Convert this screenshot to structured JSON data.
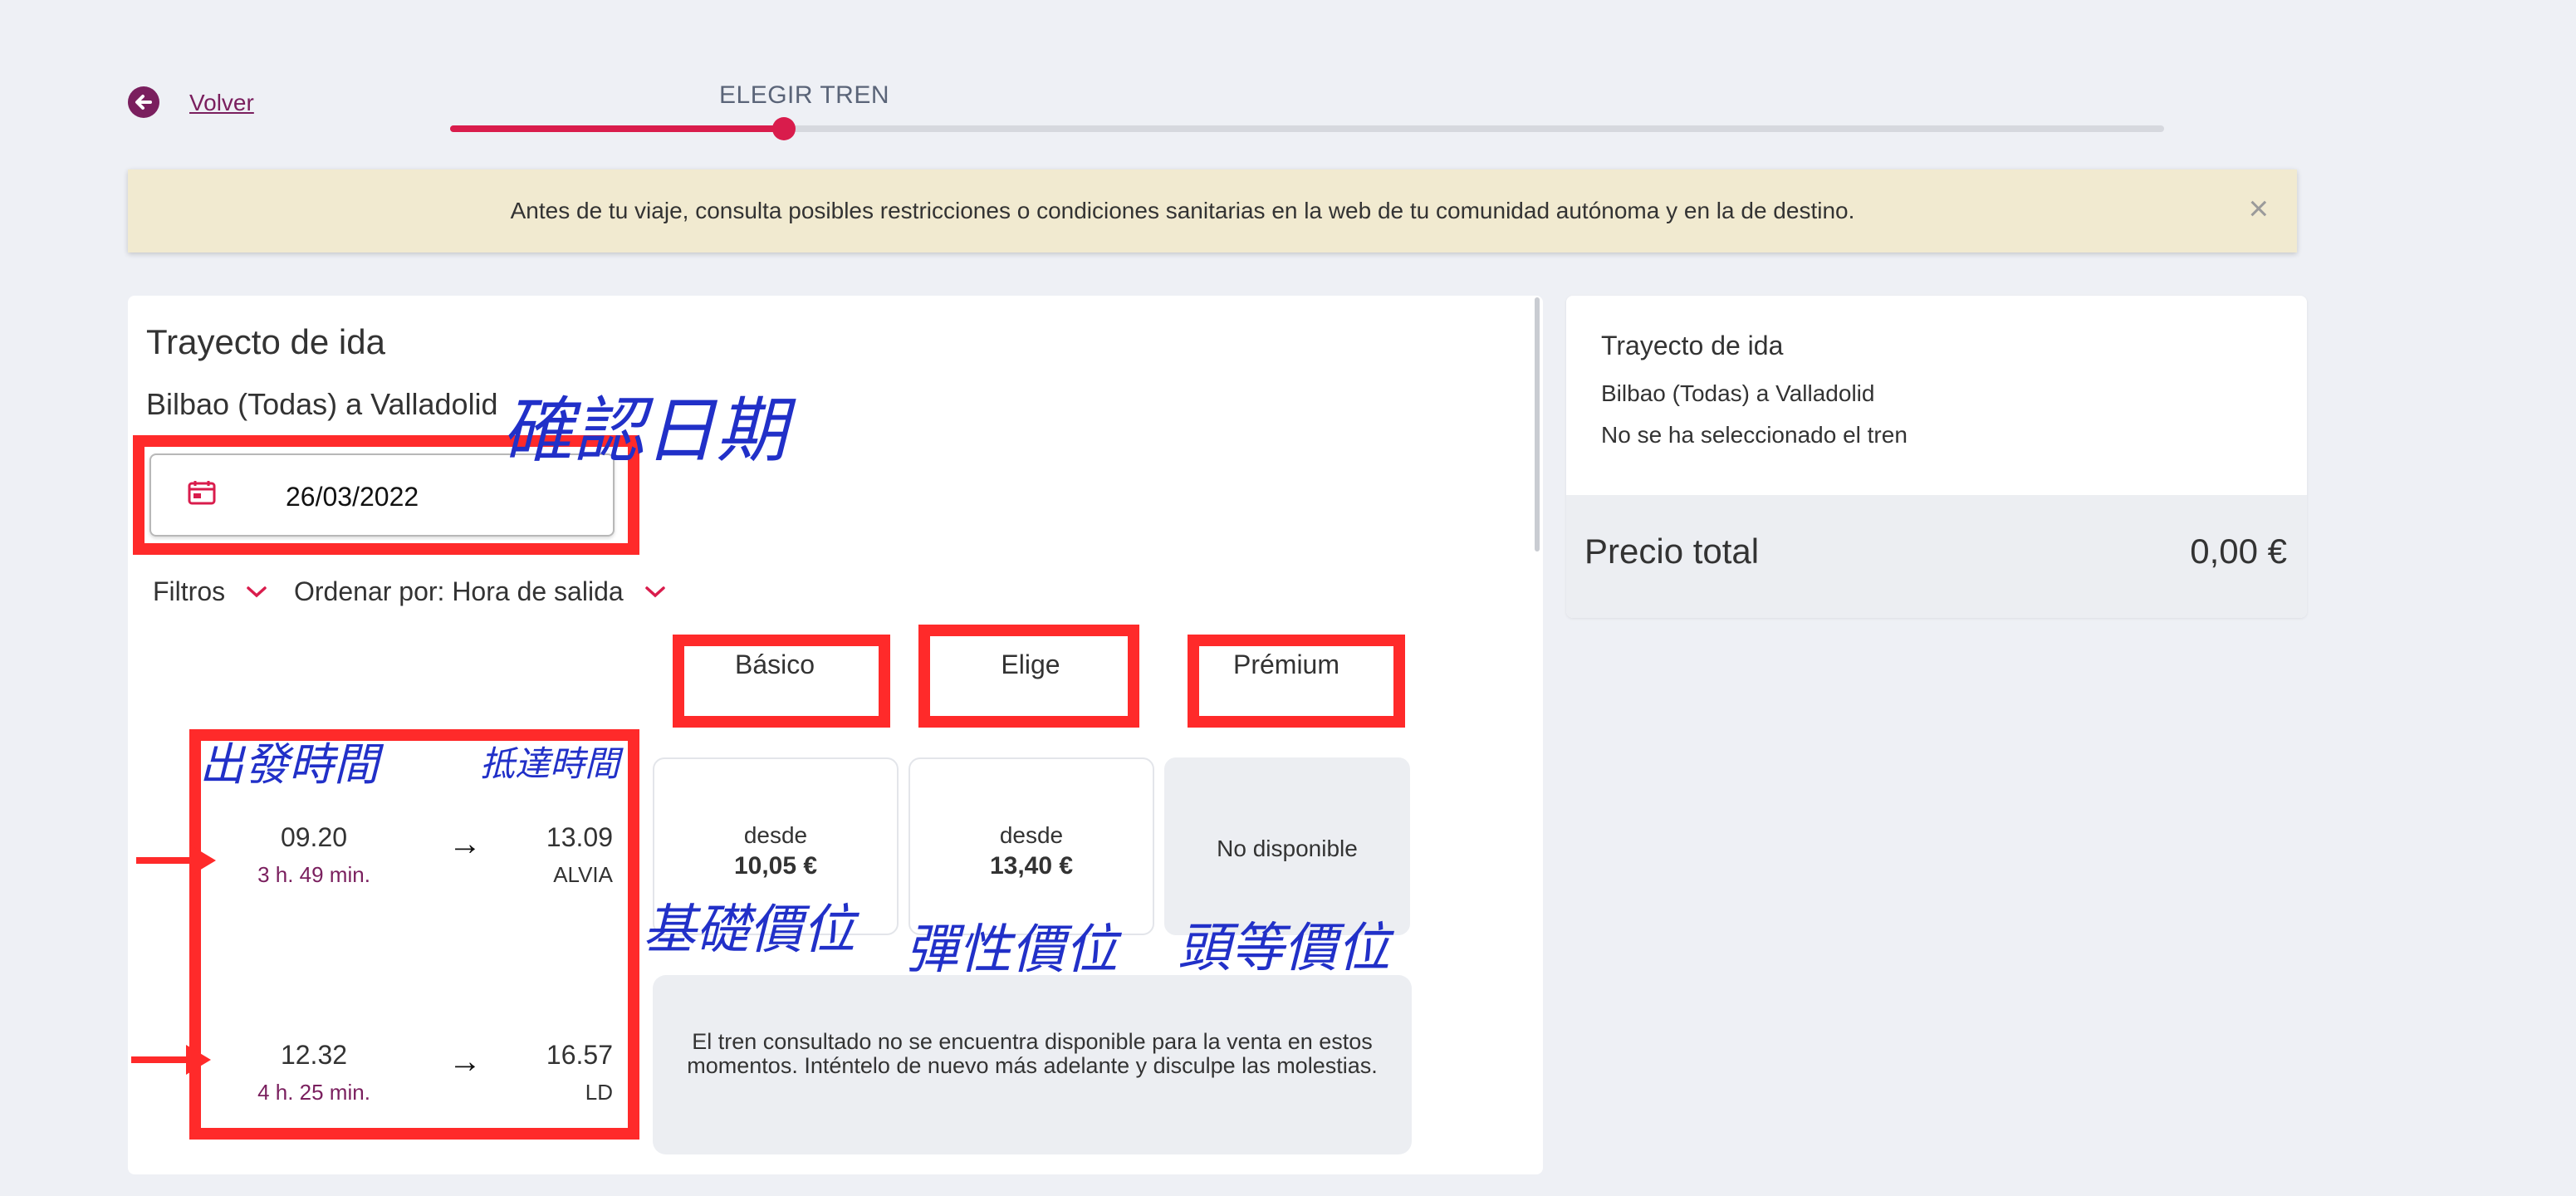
{
  "nav": {
    "back_label": "Volver",
    "step_label": "ELEGIR TREN",
    "progress": 0.195
  },
  "notice": {
    "text": "Antes de tu viaje, consulta posibles restricciones o condiciones sanitarias en la web de tu comunidad autónoma y en la de destino.",
    "close_glyph": "×"
  },
  "outbound": {
    "title": "Trayecto de ida",
    "route": "Bilbao (Todas) a Valladolid",
    "date": "26/03/2022",
    "filters_label": "Filtros",
    "sort_label": "Ordenar por: Hora de salida",
    "fare_columns": [
      "Básico",
      "Elige",
      "Prémium"
    ],
    "trains": [
      {
        "departure": "09.20",
        "duration": "3 h. 49 min.",
        "arrival": "13.09",
        "train_type": "ALVIA",
        "fares": [
          {
            "label": "desde",
            "price": "10,05 €"
          },
          {
            "label": "desde",
            "price": "13,40 €"
          },
          {
            "unavailable": "No disponible"
          }
        ]
      },
      {
        "departure": "12.32",
        "duration": "4 h. 25 min.",
        "arrival": "16.57",
        "train_type": "LD",
        "unavailable_message": "El tren consultado no se encuentra disponible para la venta en estos momentos. Inténtelo de nuevo más adelante y disculpe las molestias."
      }
    ]
  },
  "summary": {
    "title": "Trayecto de ida",
    "route": "Bilbao (Todas) a Valladolid",
    "status": "No se ha seleccionado el tren",
    "total_label": "Precio total",
    "total_value": "0,00 €"
  },
  "annotations": {
    "confirm_date": "確認日期",
    "departure_time": "出發時間",
    "arrival_time": "抵達時間",
    "basic_fare": "基礎價位",
    "flexible_fare": "彈性價位",
    "first_class_fare": "頭等價位"
  },
  "colors": {
    "accent": "#d91c4c",
    "brand": "#7a1f5e",
    "annotation_red": "#ff2a2a",
    "annotation_blue": "#2130c8"
  },
  "icons": {
    "back": "arrow-left-circle-icon",
    "calendar": "calendar-icon",
    "chevron": "chevron-down-icon",
    "arrow": "arrow-right-icon",
    "close": "close-icon"
  }
}
